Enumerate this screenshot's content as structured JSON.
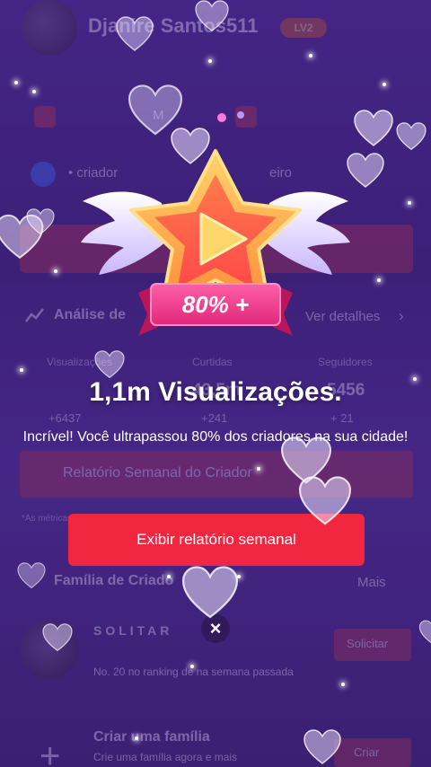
{
  "background_app": {
    "user_name": "Djanire Santos511",
    "level_badge": "LV2",
    "row1_letter": "M",
    "row2_left_text": "• criador",
    "row2_right_text": "eiro",
    "analysis_title": "Análise de",
    "analysis_link": "Ver detalhes",
    "stat_labels": [
      "Visualizações",
      "Curtidas",
      "Seguidores"
    ],
    "stat_values": [
      "1,1m",
      "43,5m",
      "5456"
    ],
    "stat_deltas": [
      "+6437",
      "+241",
      "+ 21"
    ],
    "weekly_report_title": "Relatório Semanal do Criador",
    "footnote": "*As métricas dos últimos dias",
    "family_title": "Família de Criado",
    "family_link": "Mais",
    "rank_name": "SOLITAR",
    "rank_note": "No. 20 no ranking de na semana passada",
    "rank_action": "Solicitar",
    "create_family_title": "Criar uma família",
    "create_family_sub": "Crie uma família agora e mais",
    "create_family_action": "Criar"
  },
  "modal": {
    "badge_label": "80% +",
    "title": "1,1m Visualizações.",
    "subtitle": "Incrível! Você ultrapassou 80% dos criadores na sua cidade!",
    "cta_label": "Exibir relatório semanal",
    "close_label": "×"
  },
  "colors": {
    "background": "#40267f",
    "cta": "#f0273f",
    "ribbon": "#ec3a84",
    "star_outer": "#ffb347",
    "star_inner": "#ff6a3d"
  }
}
